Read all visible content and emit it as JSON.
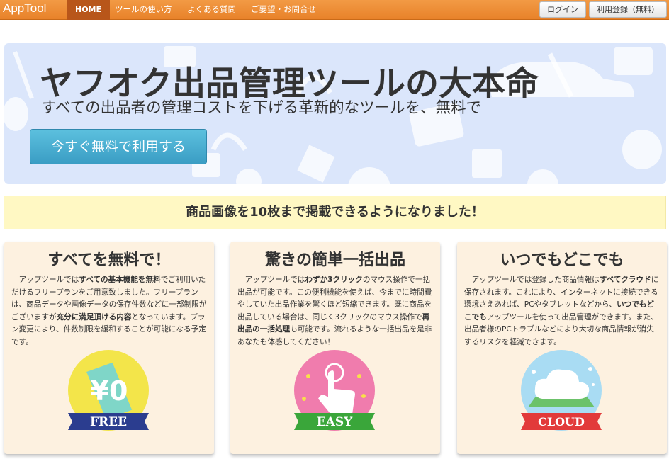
{
  "navbar": {
    "brand": "AppTool",
    "items": [
      "HOME",
      "ツールの使い方",
      "よくある質問",
      "ご要望・お問合せ"
    ],
    "login": "ログイン",
    "register": "利用登録（無料）",
    "colors": {
      "bar": "#e8822a",
      "active": "#b8561a"
    }
  },
  "hero": {
    "title": "ヤフオク出品管理ツールの大本命",
    "subtitle": "すべての出品者の管理コストを下げる革新的なツールを、無料で",
    "cta": "今すぐ無料で利用する"
  },
  "notice": "商品画像を10枚まで掲載できるようになりました！",
  "features": [
    {
      "title": "すべてを無料で！",
      "parts": [
        {
          "t": "アップツールでは"
        },
        {
          "t": "すべての基本機能を無料",
          "b": true
        },
        {
          "t": "でご利用いただけるフリープランをご用意致しました。フリープランは、商品データや画像データの保存件数などに一部制限がございますが"
        },
        {
          "t": "充分に満足頂ける内容",
          "b": true
        },
        {
          "t": "となっています。プラン変更により、件数制限を緩和することが可能になる予定です。"
        }
      ],
      "icon": "free-badge-icon",
      "badge_symbol": "¥0",
      "badge_label": "FREE"
    },
    {
      "title": "驚きの簡単一括出品",
      "parts": [
        {
          "t": "アップツールでは"
        },
        {
          "t": "わずか3クリック",
          "b": true
        },
        {
          "t": "のマウス操作で一括出品が可能です。この便利機能を使えば、今までに時間費やしていた出品作業を驚くほど短縮できます。既に商品を出品している場合は、同じく3クリックのマウス操作で"
        },
        {
          "t": "再出品の一括処理",
          "b": true
        },
        {
          "t": "も可能です。流れるような一括出品を是非あなたも体感してください！"
        }
      ],
      "icon": "easy-badge-icon",
      "badge_label": "EASY"
    },
    {
      "title": "いつでもどこでも",
      "parts": [
        {
          "t": "アップツールでは登録した商品情報は"
        },
        {
          "t": "すべてクラウド",
          "b": true
        },
        {
          "t": "に保存されます。これにより、インターネットに接続できる環境さえあれば、PCやタブレットなどから、"
        },
        {
          "t": "いつでもどこでも",
          "b": true
        },
        {
          "t": "アップツールを使って出品管理ができます。また、出品者様のPCトラブルなどにより大切な商品情報が消失するリスクを軽減できます。"
        }
      ],
      "icon": "cloud-badge-icon",
      "badge_label": "CLOUD"
    }
  ]
}
